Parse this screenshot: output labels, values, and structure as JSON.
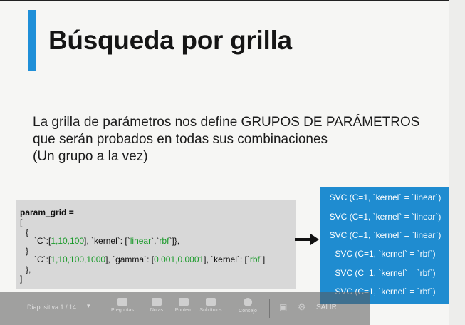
{
  "slide": {
    "title": "Búsqueda por grilla",
    "description_lines": [
      "La grilla de parámetros nos define GRUPOS DE PARÁMETROS",
      "que serán probados en todas sus combinaciones",
      "(Un grupo a la vez)"
    ],
    "accent_color": "#1f8fd8"
  },
  "code": {
    "line1": "param_grid  =",
    "line2": "[",
    "line3": "{",
    "line4_parts": [
      "`C`:[",
      "1,10,100",
      "],  `kernel`: [`",
      "linear",
      "`,`",
      "rbf",
      "`]},"
    ],
    "line5": "}",
    "line6_parts": [
      "`C`:[",
      "1,10,100,1000",
      "],  `gamma`: [",
      "0.001,0.0001",
      "],  `kernel`: [`",
      "rbf",
      "`]"
    ],
    "line7": "},",
    "line8": "]"
  },
  "svc_list": [
    "SVC (C=1,  `kernel` = `linear`)",
    "SVC (C=1,  `kernel` = `linear`)",
    "SVC (C=1,  `kernel` = `linear`)",
    "SVC (C=1,  `kernel` = `rbf`)",
    "SVC (C=1,  `kernel` = `rbf`)",
    "SVC (C=1,  `kernel` = `rbf`)"
  ],
  "toolbar": {
    "page_label": "Diapositiva  1 / 14",
    "buttons": [
      "Preguntas",
      "Notas",
      "Puntero",
      "Subtítulos",
      "Consejo"
    ],
    "exit_label": "SALIR"
  },
  "colors": {
    "panel": "#1f8cd0",
    "code_bg": "#d8d8d8",
    "green": "#1a9a2a"
  }
}
